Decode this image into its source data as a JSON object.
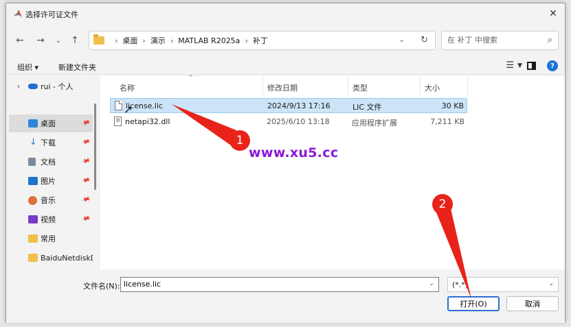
{
  "window": {
    "title": "选择许可证文件"
  },
  "address": {
    "crumbs": [
      "桌面",
      "演示",
      "MATLAB R2025a",
      "补丁"
    ]
  },
  "search": {
    "placeholder": "在 补丁 中搜索"
  },
  "toolbar": {
    "organize": "组织 ▾",
    "new_folder": "新建文件夹"
  },
  "nav": {
    "items": [
      {
        "label": "rui - 个人",
        "icon": "cloud-icon"
      },
      {
        "label": "桌面",
        "icon": "desktop-icon"
      },
      {
        "label": "下载",
        "icon": "download-icon"
      },
      {
        "label": "文档",
        "icon": "document-icon"
      },
      {
        "label": "图片",
        "icon": "picture-icon"
      },
      {
        "label": "音乐",
        "icon": "music-icon"
      },
      {
        "label": "视频",
        "icon": "video-icon"
      },
      {
        "label": "常用",
        "icon": "folder-icon"
      },
      {
        "label": "BaiduNetdiskD",
        "icon": "folder-icon"
      }
    ]
  },
  "columns": {
    "name": "名称",
    "date": "修改日期",
    "type": "类型",
    "size": "大小"
  },
  "files": [
    {
      "name": "license.lic",
      "date": "2024/9/13 17:16",
      "type": "LIC 文件",
      "size": "30 KB"
    },
    {
      "name": "netapi32.dll",
      "date": "2025/6/10 13:18",
      "type": "应用程序扩展",
      "size": "7,211 KB"
    }
  ],
  "bottom": {
    "filename_label": "文件名(N):",
    "filename_value": "license.lic",
    "filter_value": "(*.*)",
    "open_label": "打开(O)",
    "cancel_label": "取消"
  },
  "overlay": {
    "watermark": "www.xu5.cc",
    "callout_1": "1",
    "callout_2": "2"
  },
  "colors": {
    "accent": "#1e73d8",
    "selection": "#cce4f7",
    "callout": "#e8231a",
    "watermark": "#8a18d8"
  }
}
